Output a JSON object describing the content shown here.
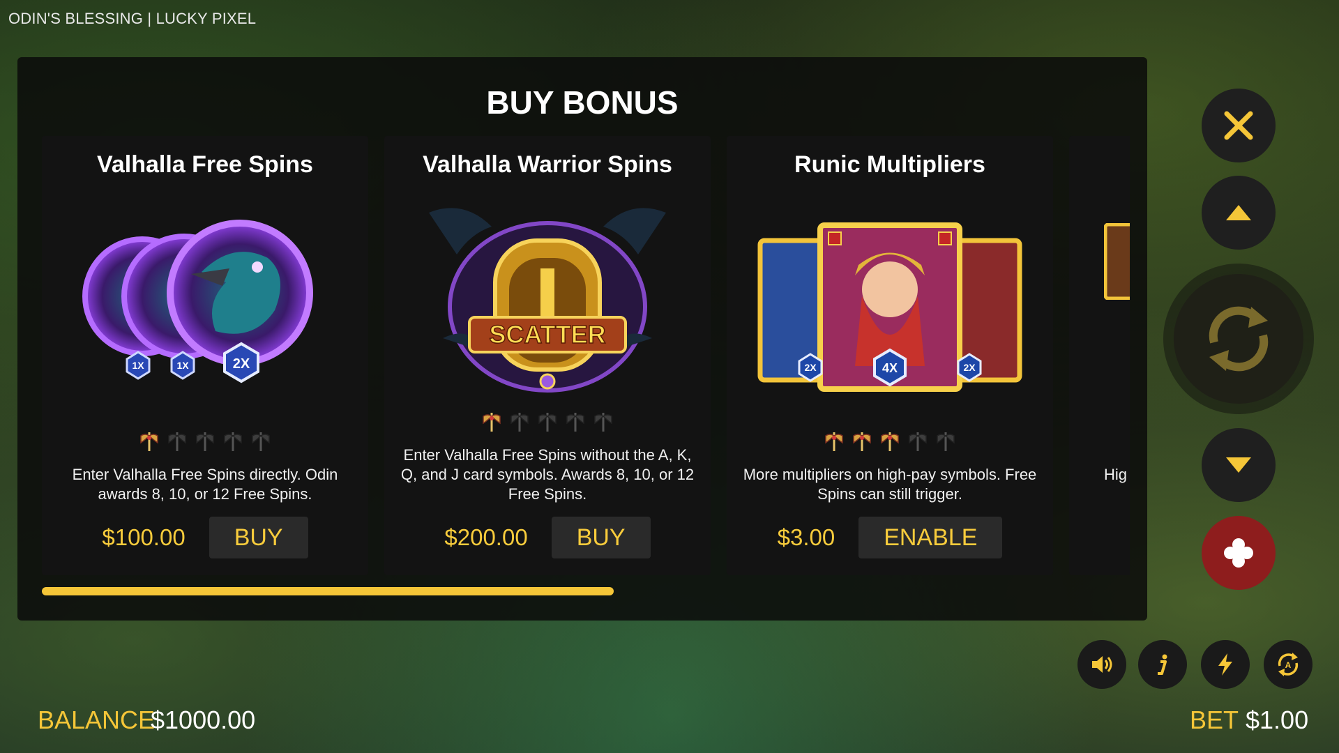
{
  "window": {
    "title": "ODIN'S BLESSING | LUCKY PIXEL"
  },
  "panel": {
    "title": "BUY BONUS"
  },
  "cards": [
    {
      "title": "Valhalla Free Spins",
      "art": "raven-coins-art",
      "badges": [
        "1X",
        "1X",
        "2X"
      ],
      "volatility": 1,
      "description": "Enter Valhalla Free Spins directly. Odin awards 8, 10, or 12 Free Spins.",
      "price": "$100.00",
      "action": "BUY"
    },
    {
      "title": "Valhalla Warrior Spins",
      "art": "scatter-ravens-art",
      "scatter_label": "SCATTER",
      "volatility": 1,
      "description": "Enter Valhalla Free Spins without the A, K, Q, and J card symbols. Awards 8, 10, or 12 Free Spins.",
      "price": "$200.00",
      "action": "BUY"
    },
    {
      "title": "Runic Multipliers",
      "art": "warrior-cards-art",
      "badges": [
        "2X",
        "4X",
        "2X"
      ],
      "volatility": 3,
      "description": "More multipliers on high-pay symbols. Free Spins can still trigger.",
      "price": "$3.00",
      "action": "ENABLE"
    },
    {
      "title": "",
      "description": "Hig",
      "partial": true
    }
  ],
  "scroll_progress": 0.43,
  "controls": {
    "close": "close-icon",
    "up": "arrow-up-icon",
    "spin": "spin-icon",
    "down": "arrow-down-icon",
    "bonus": "bonus-icon",
    "sound": "sound-icon",
    "info": "info-icon",
    "turbo": "lightning-icon",
    "autoplay": "autoplay-icon"
  },
  "footer": {
    "balance_label": "BALANCE",
    "balance_value": "$1000.00",
    "bet_label": "BET",
    "bet_value": "$1.00"
  },
  "colors": {
    "accent": "#f5c638",
    "price": "#f8cc3c",
    "bonus_button": "#8e1d1d",
    "card_bg": "#131313"
  }
}
